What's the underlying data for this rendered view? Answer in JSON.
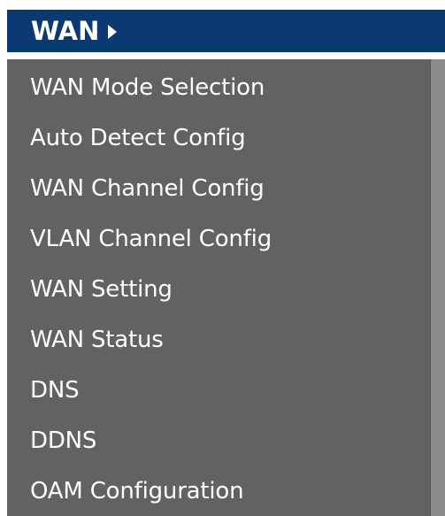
{
  "header": {
    "title": "WAN"
  },
  "menu": {
    "items": [
      {
        "label": "WAN Mode Selection"
      },
      {
        "label": "Auto Detect Config"
      },
      {
        "label": "WAN Channel Config"
      },
      {
        "label": "VLAN Channel Config"
      },
      {
        "label": "WAN Setting"
      },
      {
        "label": "WAN Status"
      },
      {
        "label": "DNS"
      },
      {
        "label": "DDNS"
      },
      {
        "label": "OAM Configuration"
      }
    ]
  },
  "colors": {
    "header_bg": "#0b3a72",
    "menu_bg": "#626262",
    "scroll_strip": "#8c8c8c",
    "text": "#ffffff"
  },
  "icons": {
    "header_arrow": "arrow-right-icon"
  }
}
